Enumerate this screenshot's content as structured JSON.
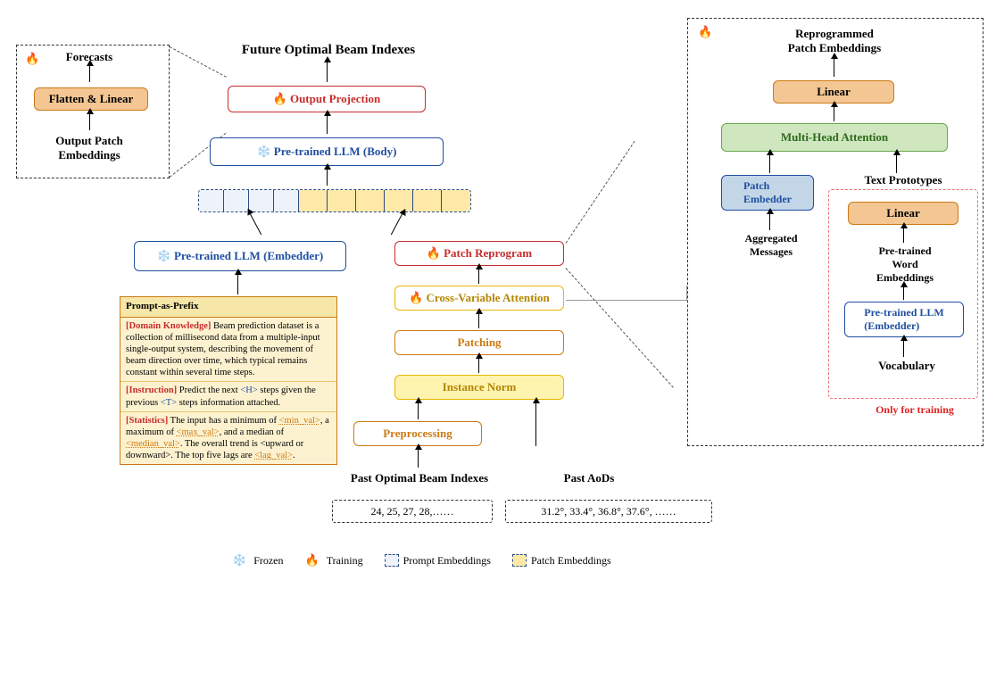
{
  "title_top": "Future Optimal Beam Indexes",
  "center": {
    "output_projection": "Output Projection",
    "pretrained_body": "Pre-trained LLM (Body)",
    "pretrained_embedder": "Pre-trained LLM (Embedder)",
    "patch_reprogram": "Patch Reprogram",
    "cross_var_attn": "Cross-Variable Attention",
    "patching": "Patching",
    "instance_norm": "Instance Norm",
    "preprocessing": "Preprocessing"
  },
  "left_panel": {
    "forecasts": "Forecasts",
    "flatten_linear": "Flatten & Linear",
    "output_patch_emb": "Output Patch\nEmbeddings"
  },
  "right_panel": {
    "reprog_patch_emb": "Reprogrammed\nPatch Embeddings",
    "linear_top": "Linear",
    "mha": "Multi-Head Attention",
    "patch_embedder": "Patch\nEmbedder",
    "text_prototypes": "Text Prototypes",
    "linear_mid": "Linear",
    "pretrained_word_emb": "Pre-trained\nWord\nEmbeddings",
    "pretrained_llm_emb": "Pre-trained LLM\n(Embedder)",
    "agg_messages": "Aggregated\nMessages",
    "vocabulary": "Vocabulary",
    "only_training": "Only for training"
  },
  "inputs": {
    "past_beam_label": "Past Optimal Beam Indexes",
    "past_aod_label": "Past AoDs",
    "past_beam_data": "24, 25, 27, 28,……",
    "past_aod_data": "31.2°, 33.4°, 36.8°, 37.6°, ……"
  },
  "prompt": {
    "title": "Prompt-as-Prefix",
    "domain_tag": "[Domain Knowledge]",
    "domain_text": " Beam prediction dataset is a collection of millisecond data from a multiple-input single-output system, describing the movement of beam direction over time, which typical remains constant within several time steps.",
    "instr_tag": "[Instruction]",
    "instr_text_a": " Predict the next ",
    "instr_H": "<H>",
    "instr_text_b": " steps given the previous ",
    "instr_T": "<T>",
    "instr_text_c": " steps information attached.",
    "stats_tag": "[Statistics]",
    "stats_a": " The input has a minimum of ",
    "stats_min": "<min_val>",
    "stats_b": ", a maximum of ",
    "stats_max": "<max_val>",
    "stats_c": ", and a median of ",
    "stats_med": "<median_val>",
    "stats_d": ". The overall trend is <upward or downward>. The top five lags are ",
    "stats_lag": "<lag_val>",
    "stats_e": "."
  },
  "legend": {
    "frozen": "Frozen",
    "training": "Training",
    "prompt_emb": "Prompt Embeddings",
    "patch_emb": "Patch Embeddings"
  },
  "icons": {
    "flame": "🔥",
    "snow": "❄️"
  }
}
